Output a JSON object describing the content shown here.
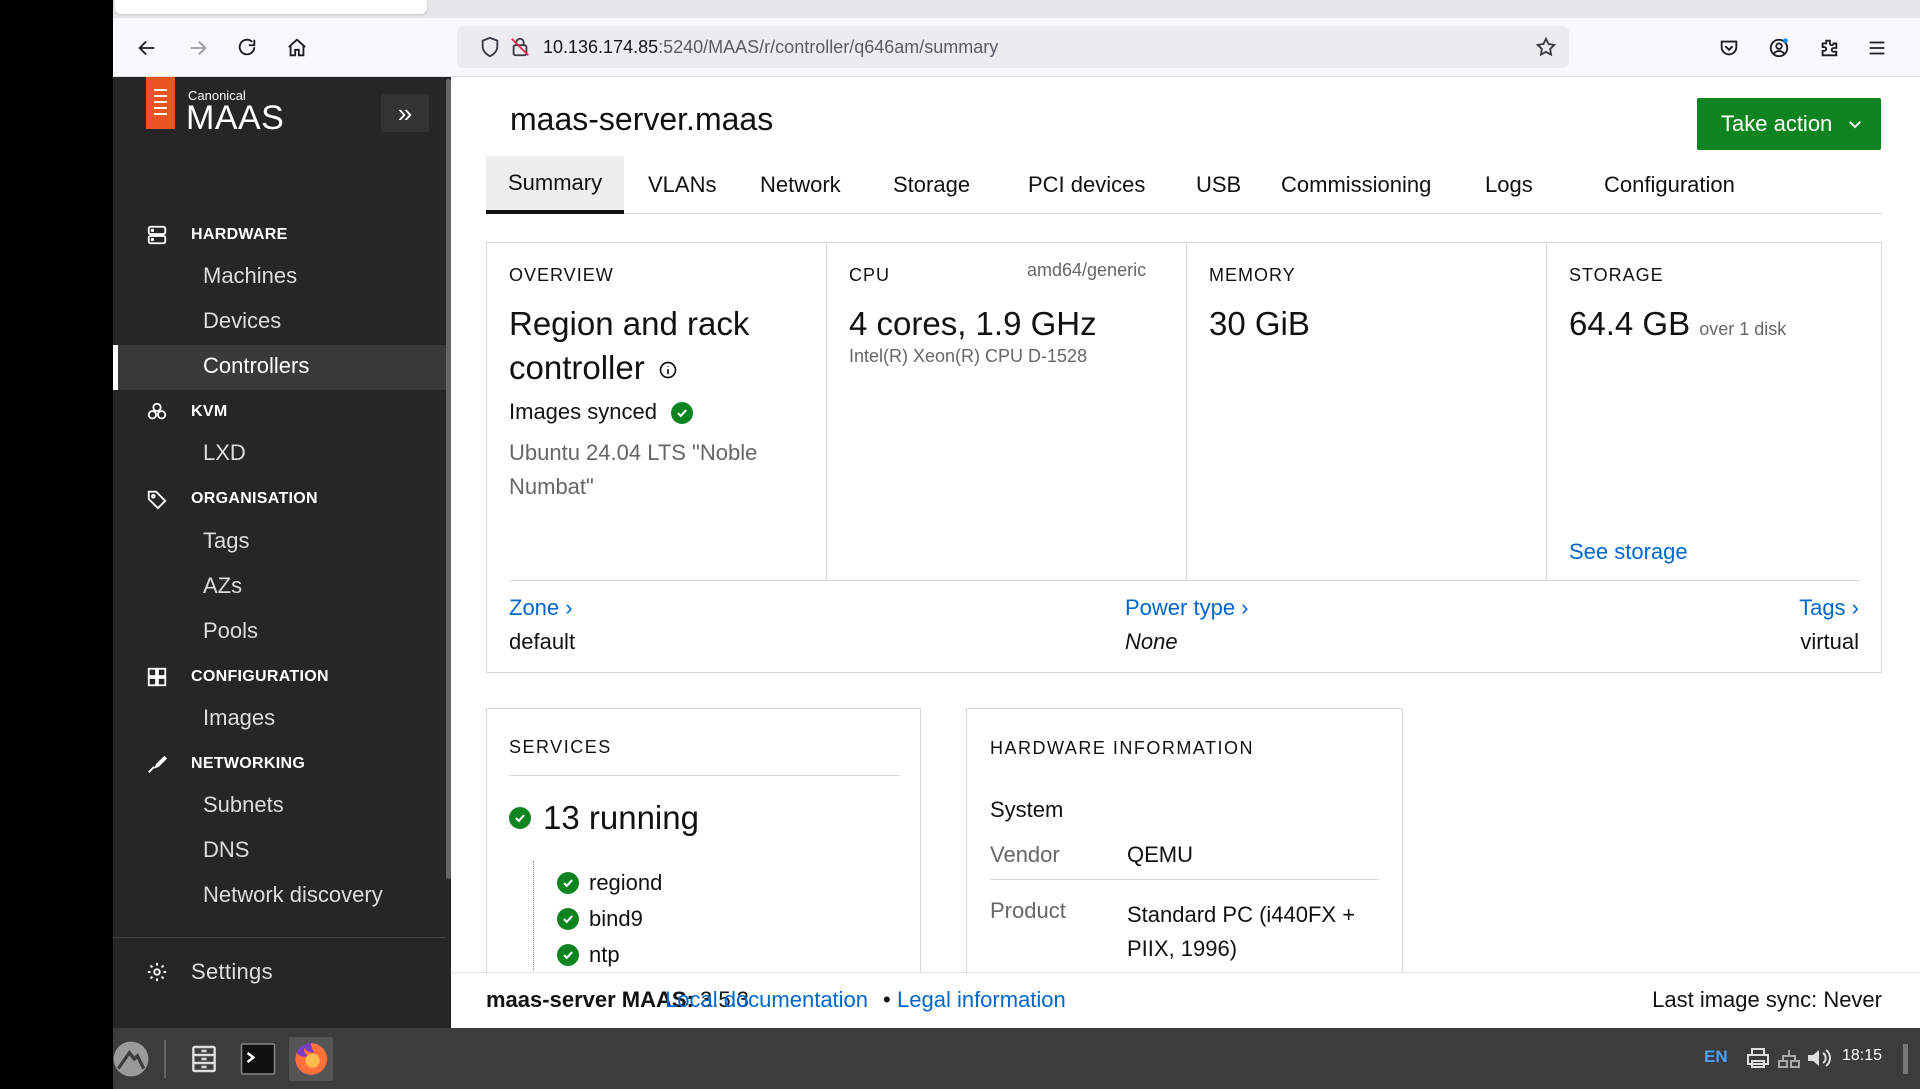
{
  "browser": {
    "url_host": "10.136.174.85",
    "url_rest": ":5240/MAAS/r/controller/q646am/summary"
  },
  "sidebar": {
    "logo_small": "Canonical",
    "logo_big": "MAAS",
    "sections": [
      {
        "title": "HARDWARE",
        "icon": "hardware-icon",
        "items": [
          "Machines",
          "Devices",
          "Controllers"
        ]
      },
      {
        "title": "KVM",
        "icon": "kvm-icon",
        "items": [
          "LXD"
        ]
      },
      {
        "title": "ORGANISATION",
        "icon": "tag-icon",
        "items": [
          "Tags",
          "AZs",
          "Pools"
        ]
      },
      {
        "title": "CONFIGURATION",
        "icon": "configuration-icon",
        "items": [
          "Images"
        ]
      },
      {
        "title": "NETWORKING",
        "icon": "networking-icon",
        "items": [
          "Subnets",
          "DNS",
          "Network discovery"
        ]
      }
    ],
    "active_item": "Controllers",
    "settings": "Settings"
  },
  "header": {
    "title": "maas-server.maas",
    "take_action": "Take action"
  },
  "tabs": [
    "Summary",
    "VLANs",
    "Network",
    "Storage",
    "PCI devices",
    "USB",
    "Commissioning",
    "Logs",
    "Configuration"
  ],
  "active_tab": "Summary",
  "overview": {
    "label": "OVERVIEW",
    "role_line1": "Region and rack",
    "role_line2": "controller",
    "images_status": "Images synced",
    "os_line1": "Ubuntu 24.04 LTS \"Noble",
    "os_line2": "Numbat\""
  },
  "cpu": {
    "label": "CPU",
    "arch": "amd64/generic",
    "value": "4 cores, 1.9 GHz",
    "model": "Intel(R) Xeon(R) CPU D-1528"
  },
  "memory": {
    "label": "MEMORY",
    "value": "30 GiB"
  },
  "storage": {
    "label": "STORAGE",
    "value": "64.4 GB",
    "suffix": "over 1 disk",
    "link": "See storage"
  },
  "zone": {
    "label": "Zone ›",
    "value": "default"
  },
  "power_type": {
    "label": "Power type ›",
    "value": "None"
  },
  "tags": {
    "label": "Tags ›",
    "value": "virtual"
  },
  "services": {
    "label": "SERVICES",
    "summary": "13 running",
    "items": [
      "regiond",
      "bind9",
      "ntp"
    ]
  },
  "hardware_info": {
    "label": "HARDWARE INFORMATION",
    "system": "System",
    "vendor_label": "Vendor",
    "vendor": "QEMU",
    "product_label": "Product",
    "product_line1": "Standard PC (i440FX +",
    "product_line2": "PIIX, 1996)"
  },
  "footer": {
    "host": "maas-server MAAS:",
    "version": "3.5.3",
    "local_docs": "Local documentation",
    "separator": "•",
    "legal": "Legal information",
    "sync": "Last image sync: Never"
  },
  "taskbar": {
    "lang": "EN",
    "time": "18:15"
  },
  "colors": {
    "accent_green": "#0e8420",
    "link_blue": "#0066cc",
    "sidebar_bg": "#262626",
    "maas_orange": "#e95420"
  }
}
